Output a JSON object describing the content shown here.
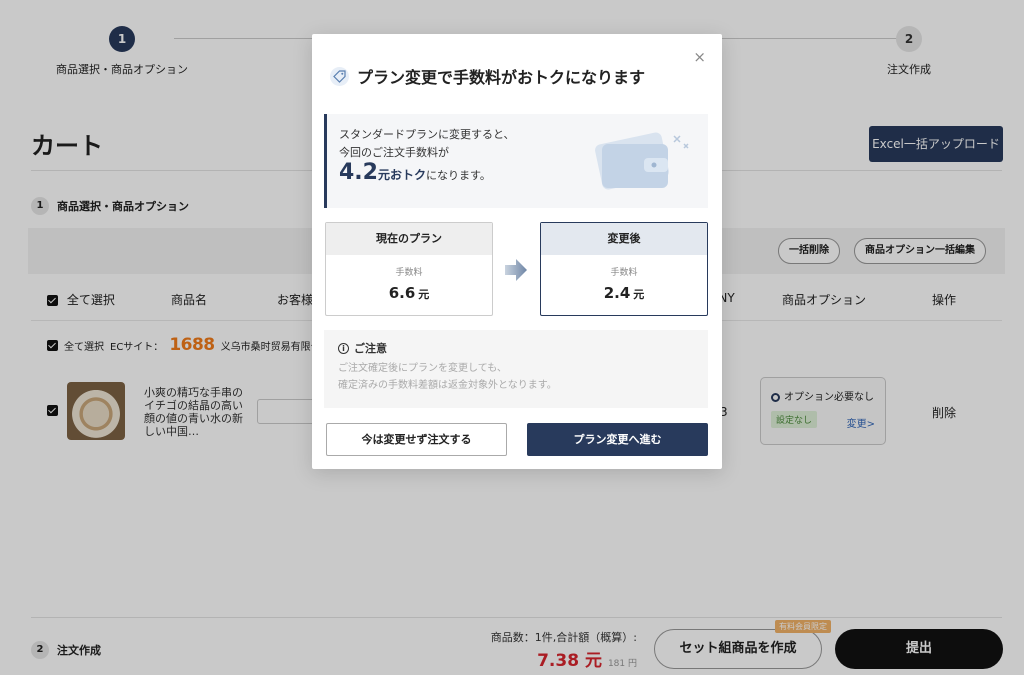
{
  "steps": [
    {
      "num": "1",
      "label": "商品選択・商品オプション"
    },
    {
      "num": "2",
      "label": "注文作成"
    }
  ],
  "cart": {
    "title": "カート",
    "excel_button": "Excel一括アップロード",
    "section1": {
      "num": "1",
      "label": "商品選択・商品オプション"
    },
    "section2": {
      "num": "2",
      "label": "注文作成"
    },
    "bulk_delete": "一括削除",
    "bulk_option_edit": "商品オプション一括編集",
    "headers": {
      "select_all": "全て選択",
      "product_name": "商品名",
      "customer": "お客様",
      "cny": "CNY",
      "product_option": "商品オプション",
      "action": "操作"
    },
    "shop_row": {
      "select_all": "全て選択",
      "ec_site_label": "ECサイト：",
      "site_logo": "1688",
      "shop_name": "义乌市桑时贸易有限公"
    },
    "item": {
      "name": "小爽の精巧な手串のイチゴの結晶の高い顔の値の青い水の新しい中国…",
      "cny_fragment": "3",
      "option_status": "オプション必要なし",
      "option_tag": "設定なし",
      "option_change": "変更>",
      "delete": "削除"
    },
    "summary": {
      "text": "商品数：1件,合計額（概算）:",
      "total": "7.38 元",
      "total_jpy": "181 円"
    },
    "set_button": "セット組商品を作成",
    "set_badge": "有料会員限定",
    "submit_button": "提出"
  },
  "modal": {
    "title": "プラン変更で手数料がおトクになります",
    "close": "×",
    "promo": {
      "line1": "スタンダードプランに変更すると、",
      "line2": "今回のご注文手数料が",
      "amount": "4.2",
      "unit": "元おトク",
      "suffix": "になります。"
    },
    "current_plan": {
      "title": "現在のプラン",
      "label": "手数料",
      "value": "6.6",
      "unit": "元"
    },
    "after_plan": {
      "title": "変更後",
      "label": "手数料",
      "value": "2.4",
      "unit": "元"
    },
    "notice": {
      "title": "ご注意",
      "line1": "ご注文確定後にプランを変更しても、",
      "line2": "確定済みの手数料差額は返金対象外となります。"
    },
    "keep_button": "今は変更せず注文する",
    "change_button": "プラン変更へ進む"
  },
  "colors": {
    "primary": "#283a5c",
    "price_red": "#d8262e",
    "site_orange": "#f27c1a"
  }
}
